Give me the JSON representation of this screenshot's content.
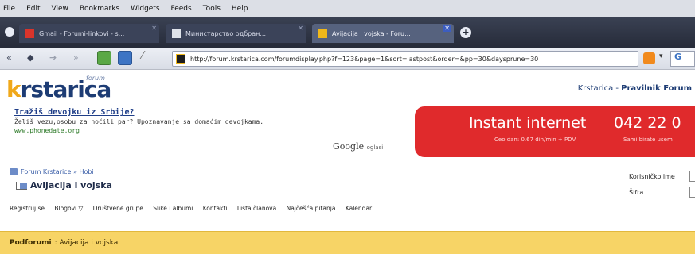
{
  "menubar": {
    "items": [
      "File",
      "Edit",
      "View",
      "Bookmarks",
      "Widgets",
      "Feeds",
      "Tools",
      "Help"
    ]
  },
  "tabs": [
    {
      "label": "Gmail - Forumi-linkovi - s...",
      "icon": "gmail-icon",
      "active": false
    },
    {
      "label": "Министарство одбран...",
      "icon": "page-icon",
      "active": false
    },
    {
      "label": "Avijacija i vojska - Foru...",
      "icon": "krstarica-icon",
      "active": true
    }
  ],
  "nav": {
    "url": "http://forum.krstarica.com/forumdisplay.php?f=123&page=1&sort=lastpost&order=&pp=30&daysprune=30",
    "search_engine_letter": "G"
  },
  "header": {
    "logo_text_k": "k",
    "logo_text_rest": "rstarica",
    "logo_sub": "forum",
    "right_text": "Krstarica - ",
    "right_link": "Pravilnik Forum"
  },
  "ad": {
    "title": "Tražiš devojku iz Srbije?",
    "desc": "Želiš vezu,osobu za noćili par? Upoznavanje sa domaćim devojkama.",
    "url": "www.phonedate.org",
    "google_label": "Google",
    "google_sub": "oglasi"
  },
  "banner": {
    "title": "Instant internet",
    "sub": "Ceo dan: 0.67 din/min + PDV",
    "phone": "042 22 0",
    "sub2": "Sami birate usem"
  },
  "breadcrumb": {
    "path": "Forum Krstarice » Hobi",
    "forum_title": "Avijacija i vojska"
  },
  "login": {
    "username_label": "Korisničko ime",
    "password_label": "Šifra"
  },
  "navlinks": [
    "Registruj se",
    "Blogovi ▽",
    "Društvene grupe",
    "Slike i albumi",
    "Kontakti",
    "Lista članova",
    "Najčešća pitanja",
    "Kalendar"
  ],
  "subforum": {
    "label": "Podforumi",
    "value": ": Avijacija i vojska"
  }
}
